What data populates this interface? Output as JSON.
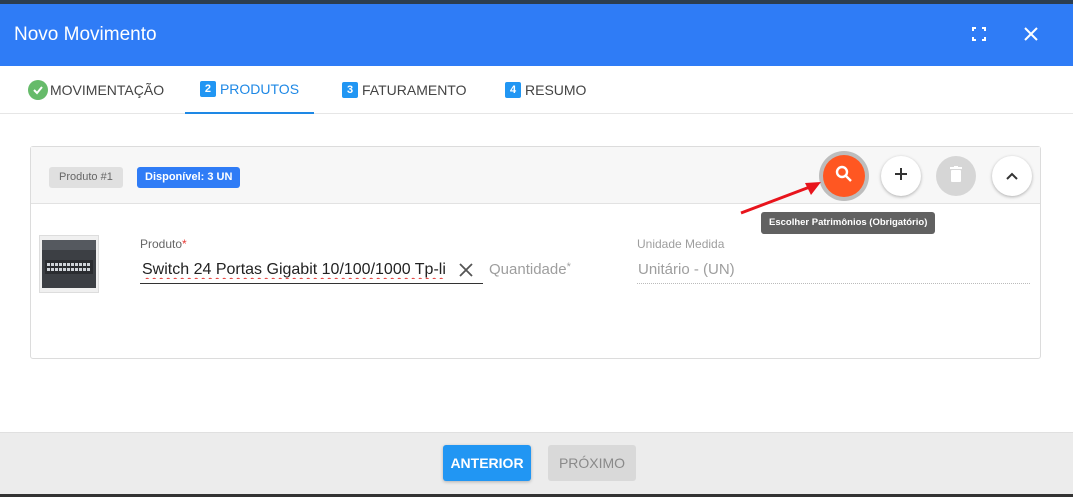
{
  "dialog": {
    "title": "Novo Movimento"
  },
  "tabs": [
    {
      "label": "MOVIMENTAÇÃO",
      "badge": ""
    },
    {
      "label": "PRODUTOS",
      "badge": "2"
    },
    {
      "label": "FATURAMENTO",
      "badge": "3"
    },
    {
      "label": "RESUMO",
      "badge": "4"
    }
  ],
  "product_card": {
    "product_chip": "Produto #1",
    "available_chip": "Disponível: 3 UN",
    "tooltip": "Escolher Patrimônios (Obrigatório)",
    "fields": {
      "produto_label": "Produto",
      "produto_value": "Switch 24 Portas Gigabit 10/100/1000 Tp-li",
      "quantidade_label": "Quantidade",
      "unidade_label": "Unidade Medida",
      "unidade_value": "Unitário - (UN)",
      "required_mark": "*"
    }
  },
  "footer": {
    "prev_label": "ANTERIOR",
    "next_label": "PRÓXIMO"
  },
  "colors": {
    "header": "#2f7cf6",
    "search_button": "#ff5722",
    "prev_button": "#2196f3",
    "done_check": "#66bb6a"
  },
  "icons": {
    "fullscreen": "fullscreen-icon",
    "close": "close-icon",
    "search": "search-icon",
    "add": "plus-icon",
    "delete": "trash-icon",
    "collapse": "chevron-up-icon",
    "clear": "clear-x-icon",
    "done": "check-circle-icon"
  }
}
